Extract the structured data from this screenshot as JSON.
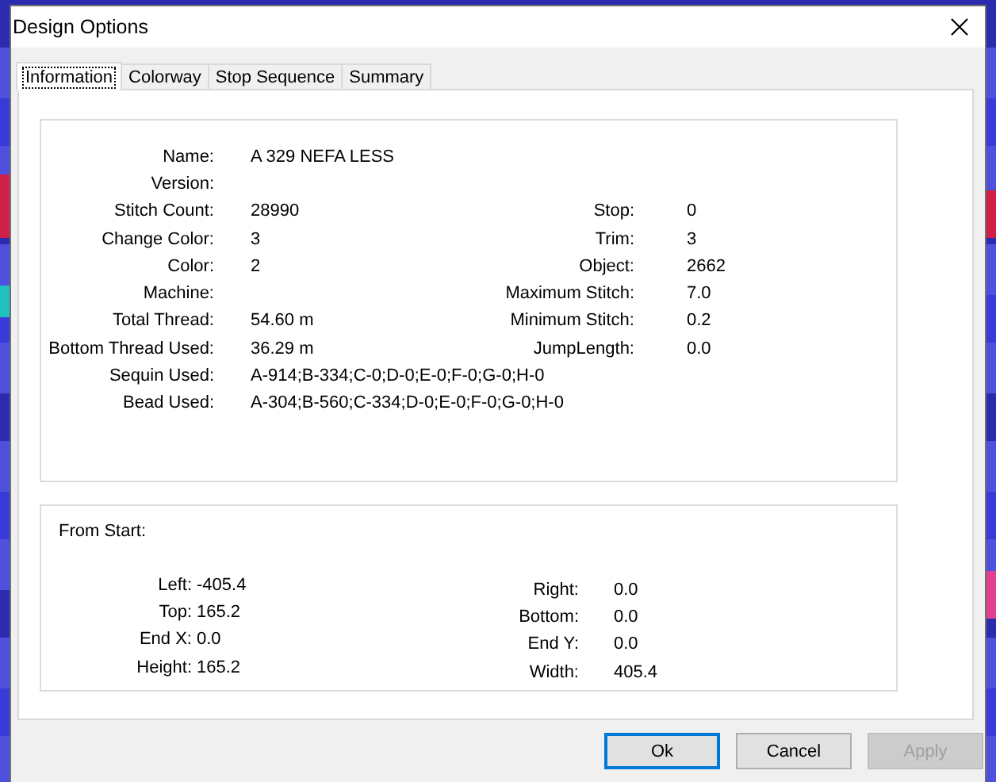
{
  "window": {
    "title": "Design Options"
  },
  "tabs": [
    {
      "label": "Information",
      "selected": true
    },
    {
      "label": "Colorway",
      "selected": false
    },
    {
      "label": "Stop Sequence",
      "selected": false
    },
    {
      "label": "Summary",
      "selected": false
    }
  ],
  "information": {
    "name": {
      "label": "Name:",
      "value": "A 329 NEFA LESS"
    },
    "fields": [
      {
        "label": "Version:"
      },
      {
        "label": "Stitch Count:",
        "value": "28990"
      },
      {
        "label": "Change Color:",
        "value": "3"
      },
      {
        "label": "Color:",
        "value": "2"
      },
      {
        "label": "Machine:"
      },
      {
        "label": "Total Thread:",
        "value": "54.60 m"
      },
      {
        "label": "Bottom Thread Used:",
        "value": "36.29 m"
      },
      {
        "label": "Sequin Used:",
        "value": "A-914;B-334;C-0;D-0;E-0;F-0;G-0;H-0"
      },
      {
        "label": "Bead Used:",
        "value": "A-304;B-560;C-334;D-0;E-0;F-0;G-0;H-0"
      }
    ],
    "stats": [
      {
        "label": "Stop:",
        "value": "0"
      },
      {
        "label": "Trim:",
        "value": "3"
      },
      {
        "label": "Object:",
        "value": "2662"
      },
      {
        "label": "Maximum Stitch:",
        "value": "7.0"
      },
      {
        "label": "Minimum Stitch:",
        "value": "0.2"
      },
      {
        "label": "JumpLength:",
        "value": "0.0"
      }
    ]
  },
  "from_start": {
    "title": "From Start:",
    "left": [
      {
        "label": "Left:",
        "value": "-405.4"
      },
      {
        "label": "Top:",
        "value": "165.2"
      },
      {
        "label": "End X:",
        "value": "0.0"
      },
      {
        "label": "Height:",
        "value": "165.2"
      }
    ],
    "right": [
      {
        "label": "Right:",
        "value": "0.0"
      },
      {
        "label": "Bottom:",
        "value": "0.0"
      },
      {
        "label": "End Y:",
        "value": "0.0"
      },
      {
        "label": "Width:",
        "value": "405.4"
      }
    ]
  },
  "buttons": [
    {
      "label": "Ok",
      "default": true,
      "disabled": false
    },
    {
      "label": "Cancel",
      "default": false,
      "disabled": false
    },
    {
      "label": "Apply",
      "default": false,
      "disabled": true
    }
  ]
}
